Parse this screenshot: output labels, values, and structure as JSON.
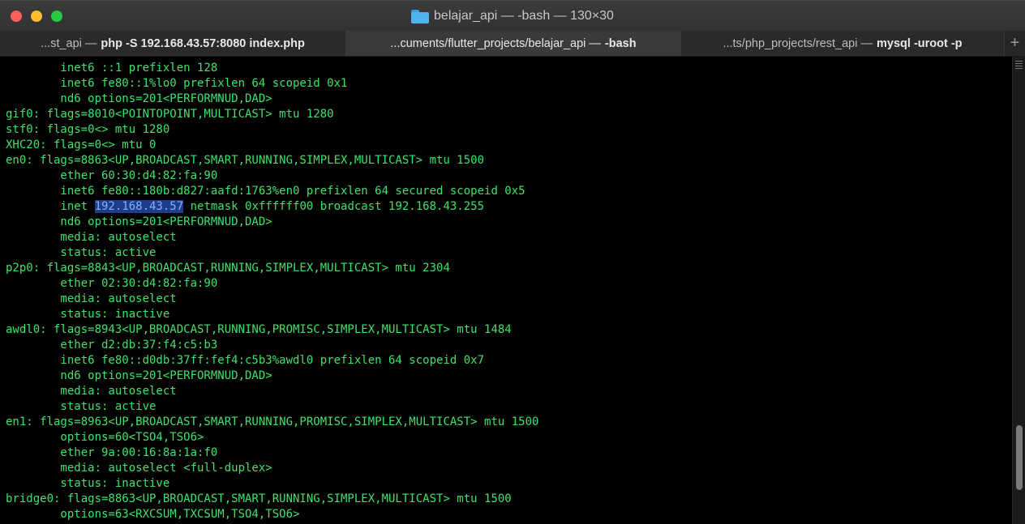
{
  "window": {
    "title": "belajar_api — -bash — 130×30",
    "folder_icon": "folder-icon"
  },
  "tabs": [
    {
      "prefix": "...st_api — ",
      "command": "php -S 192.168.43.57:8080 index.php",
      "active": false
    },
    {
      "prefix": "...cuments/flutter_projects/belajar_api — ",
      "command": "-bash",
      "active": true
    },
    {
      "prefix": "...ts/php_projects/rest_api — ",
      "command": "mysql -uroot -p",
      "active": false
    }
  ],
  "new_tab_label": "+",
  "terminal": {
    "lines": [
      "        inet6 ::1 prefixlen 128",
      "        inet6 fe80::1%lo0 prefixlen 64 scopeid 0x1",
      "        nd6 options=201<PERFORMNUD,DAD>",
      "gif0: flags=8010<POINTOPOINT,MULTICAST> mtu 1280",
      "stf0: flags=0<> mtu 1280",
      "XHC20: flags=0<> mtu 0",
      "en0: flags=8863<UP,BROADCAST,SMART,RUNNING,SIMPLEX,MULTICAST> mtu 1500",
      "        ether 60:30:d4:82:fa:90",
      "        inet6 fe80::180b:d827:aafd:1763%en0 prefixlen 64 secured scopeid 0x5",
      "        nd6 options=201<PERFORMNUD,DAD>",
      "        media: autoselect",
      "        status: active",
      "p2p0: flags=8843<UP,BROADCAST,RUNNING,SIMPLEX,MULTICAST> mtu 2304",
      "        ether 02:30:d4:82:fa:90",
      "        media: autoselect",
      "        status: inactive",
      "awdl0: flags=8943<UP,BROADCAST,RUNNING,PROMISC,SIMPLEX,MULTICAST> mtu 1484",
      "        ether d2:db:37:f4:c5:b3",
      "        inet6 fe80::d0db:37ff:fef4:c5b3%awdl0 prefixlen 64 scopeid 0x7",
      "        nd6 options=201<PERFORMNUD,DAD>",
      "        media: autoselect",
      "        status: active",
      "en1: flags=8963<UP,BROADCAST,SMART,RUNNING,PROMISC,SIMPLEX,MULTICAST> mtu 1500",
      "        options=60<TSO4,TSO6>",
      "        ether 9a:00:16:8a:1a:f0",
      "        media: autoselect <full-duplex>",
      "        status: inactive",
      "bridge0: flags=8863<UP,BROADCAST,SMART,RUNNING,SIMPLEX,MULTICAST> mtu 1500",
      "        options=63<RXCSUM,TXCSUM,TSO4,TSO6>"
    ],
    "inet_line": {
      "before": "        inet ",
      "selected": "192.168.43.57",
      "after": " netmask 0xffffff00 broadcast 192.168.43.255"
    }
  },
  "colors": {
    "text": "#3ee26a",
    "selection_bg": "#1f3d8a",
    "selection_text": "#7fb2ff"
  }
}
